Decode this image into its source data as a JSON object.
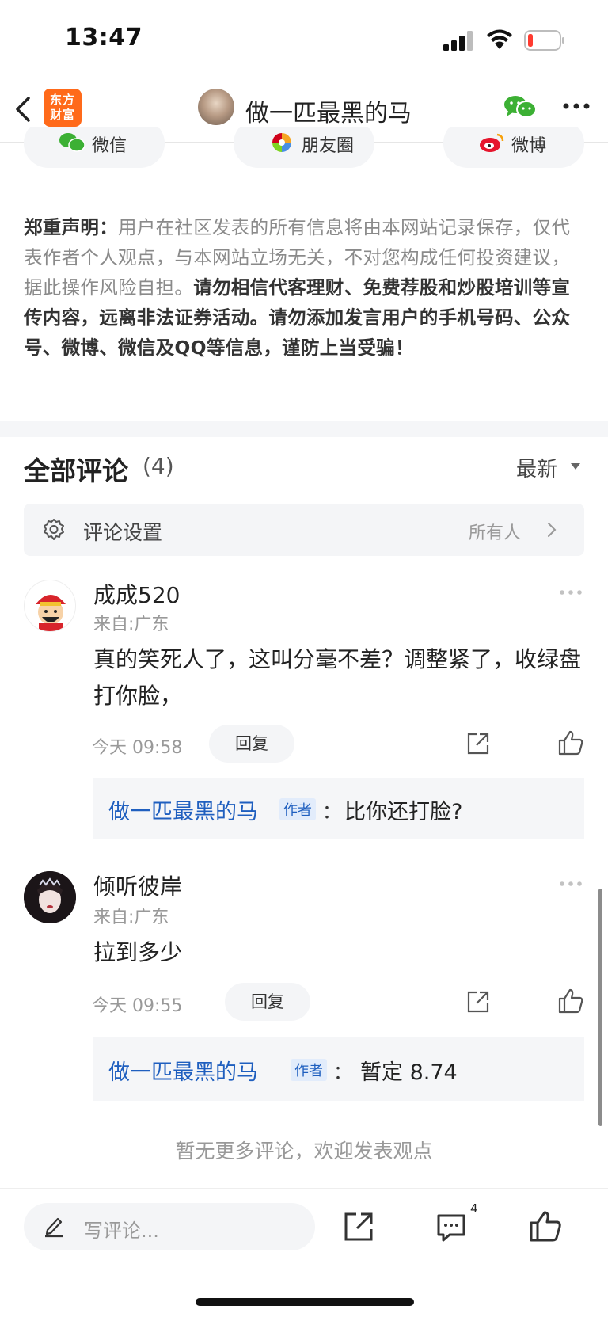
{
  "status_bar": {
    "time": "13:47"
  },
  "nav": {
    "logo_line1": "东方",
    "logo_line2": "财富",
    "title": "做一匹最黑的马"
  },
  "share": {
    "wechat": "微信",
    "moments": "朋友圈",
    "weibo": "微博"
  },
  "disclaimer": {
    "label": "郑重声明：",
    "normal": "用户在社区发表的所有信息将由本网站记录保存，仅代表作者个人观点，与本网站立场无关，不对您构成任何投资建议，据此操作风险自担。",
    "bold": "请勿相信代客理财、免费荐股和炒股培训等宣传内容，远离非法证券活动。请勿添加发言用户的手机号码、公众号、微博、微信及QQ等信息，谨防上当受骗！"
  },
  "comments_header": {
    "title": "全部评论",
    "count": "(4)",
    "sort": "最新"
  },
  "settings": {
    "label": "评论设置",
    "value": "所有人"
  },
  "comments": [
    {
      "user": "成成520",
      "from": "来自:广东",
      "text": "真的笑死人了，这叫分毫不差？调整紧了，收绿盘打你脸，",
      "time": "今天 09:58",
      "reply_label": "回复",
      "reply": {
        "author": "做一匹最黑的马",
        "tag": "作者",
        "colon": "：",
        "text": "比你还打脸?"
      }
    },
    {
      "user": "倾听彼岸",
      "from": "来自:广东",
      "text": "拉到多少",
      "time": "今天 09:55",
      "reply_label": "回复",
      "reply": {
        "author": "做一匹最黑的马",
        "tag": "作者",
        "colon": "：",
        "text": "暂定 8.74"
      }
    }
  ],
  "no_more": "暂无更多评论，欢迎发表观点",
  "bottom": {
    "placeholder": "写评论...",
    "comment_badge": "4"
  },
  "colors": {
    "brand_orange": "#ff6a1a",
    "link_blue": "#1f5fbf",
    "wechat_green": "#3cb034"
  }
}
